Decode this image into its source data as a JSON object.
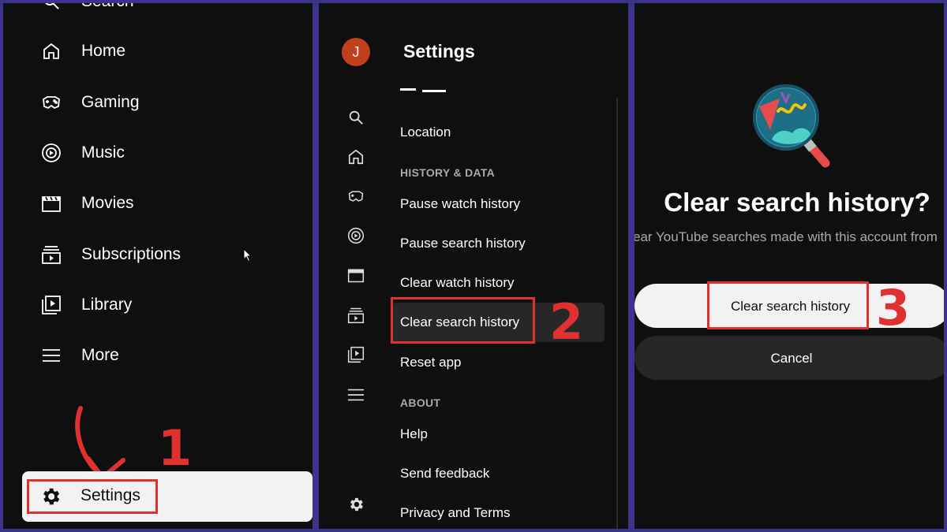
{
  "sidebar": {
    "items": [
      {
        "label": "Search",
        "icon": "search-icon"
      },
      {
        "label": "Home",
        "icon": "home-icon"
      },
      {
        "label": "Gaming",
        "icon": "gamepad-icon"
      },
      {
        "label": "Music",
        "icon": "music-icon"
      },
      {
        "label": "Movies",
        "icon": "clapperboard-icon"
      },
      {
        "label": "Subscriptions",
        "icon": "subscriptions-icon"
      },
      {
        "label": "Library",
        "icon": "library-icon"
      },
      {
        "label": "More",
        "icon": "menu-icon"
      }
    ],
    "settings_label": "Settings",
    "settings_icon": "gear-icon"
  },
  "settings_page": {
    "avatar_initial": "J",
    "title": "Settings",
    "items": [
      {
        "label": "Location"
      },
      {
        "label": "HISTORY & DATA",
        "type": "header"
      },
      {
        "label": "Pause watch history"
      },
      {
        "label": "Pause search history"
      },
      {
        "label": "Clear watch history"
      },
      {
        "label": "Clear search history",
        "selected": true
      },
      {
        "label": "Reset app"
      },
      {
        "label": "ABOUT",
        "type": "header"
      },
      {
        "label": "Help"
      },
      {
        "label": "Send feedback"
      },
      {
        "label": "Privacy and Terms"
      }
    ]
  },
  "dialog": {
    "title": "Clear search history?",
    "subtitle": "ear YouTube searches made with this account from",
    "confirm_label": "Clear search history",
    "cancel_label": "Cancel",
    "illustration_icon": "magnifier-illustration-icon"
  },
  "steps": [
    "1",
    "2",
    "3"
  ],
  "colors": {
    "highlight": "#e03131",
    "background": "#0f0f0f",
    "frame": "#3a3588",
    "avatar": "#c1401c"
  }
}
